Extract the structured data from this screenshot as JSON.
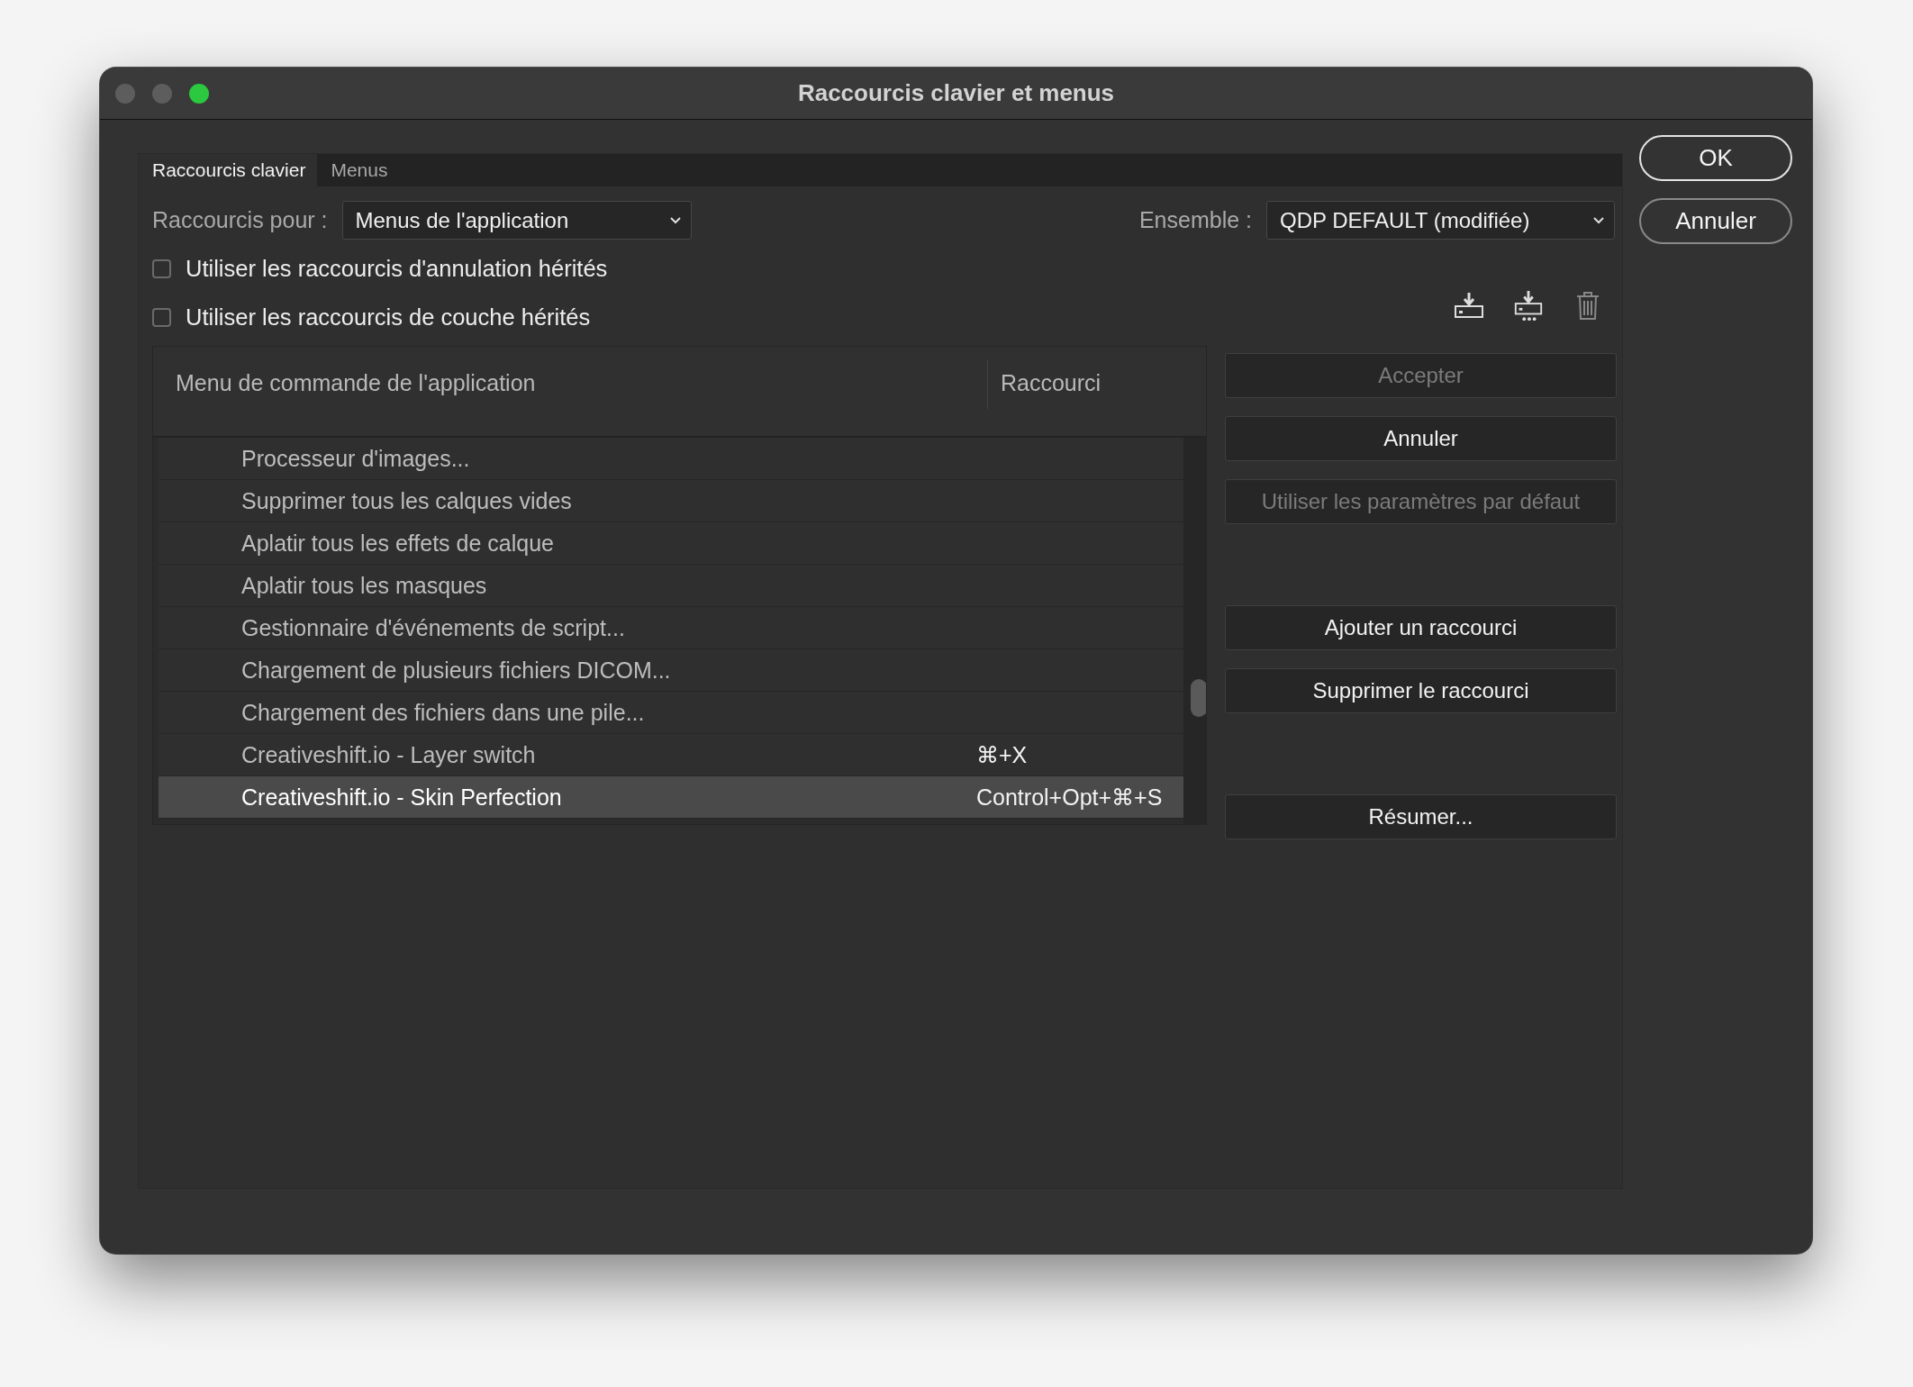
{
  "window": {
    "title": "Raccourcis clavier et menus"
  },
  "tabs": [
    {
      "label": "Raccourcis clavier",
      "selected": true
    },
    {
      "label": "Menus",
      "selected": false
    }
  ],
  "shortcuts_for": {
    "label": "Raccourcis pour :",
    "value": "Menus de l'application"
  },
  "set": {
    "label": "Ensemble :",
    "value": "QDP DEFAULT (modifiée)"
  },
  "options": [
    {
      "label": "Utiliser les raccourcis d'annulation hérités",
      "checked": false
    },
    {
      "label": "Utiliser les raccourcis de couche hérités",
      "checked": false
    }
  ],
  "table": {
    "columns": [
      "Menu de commande de l'application",
      "Raccourci"
    ],
    "rows": [
      {
        "command": "Processeur d'images...",
        "shortcut": "",
        "selected": false
      },
      {
        "command": "Supprimer tous les calques vides",
        "shortcut": "",
        "selected": false
      },
      {
        "command": "Aplatir tous les effets de calque",
        "shortcut": "",
        "selected": false
      },
      {
        "command": "Aplatir tous les masques",
        "shortcut": "",
        "selected": false
      },
      {
        "command": "Gestionnaire d'événements de script...",
        "shortcut": "",
        "selected": false
      },
      {
        "command": "Chargement de plusieurs fichiers DICOM...",
        "shortcut": "",
        "selected": false
      },
      {
        "command": "Chargement des fichiers dans une pile...",
        "shortcut": "",
        "selected": false
      },
      {
        "command": "Creativeshift.io - Layer switch",
        "shortcut": "⌘+X",
        "selected": false
      },
      {
        "command": "Creativeshift.io - Skin Perfection",
        "shortcut": "Control+Opt+⌘+S",
        "selected": true
      }
    ]
  },
  "side_button_groups": [
    [
      {
        "label": "Accepter",
        "disabled": true
      },
      {
        "label": "Annuler",
        "disabled": false
      },
      {
        "label": "Utiliser les paramètres par défaut",
        "disabled": true
      }
    ],
    [
      {
        "label": "Ajouter un raccourci",
        "disabled": false
      },
      {
        "label": "Supprimer le raccourci",
        "disabled": false
      }
    ],
    [
      {
        "label": "Résumer...",
        "disabled": false
      }
    ]
  ],
  "dialog_buttons": [
    {
      "label": "OK",
      "default": true
    },
    {
      "label": "Annuler",
      "default": false
    }
  ]
}
